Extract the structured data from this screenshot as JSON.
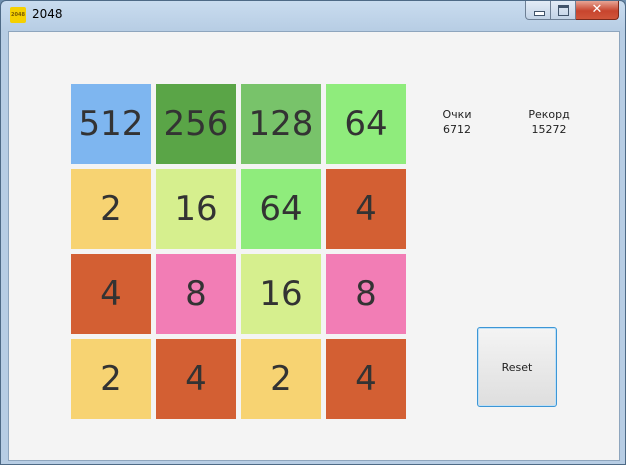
{
  "window": {
    "title": "2048",
    "icon_text": "2048",
    "close_glyph": "✕"
  },
  "board": {
    "tiles": [
      {
        "value": "512",
        "color": "#7eb6f0"
      },
      {
        "value": "256",
        "color": "#5aa547"
      },
      {
        "value": "128",
        "color": "#78c36a"
      },
      {
        "value": "64",
        "color": "#8fec7c"
      },
      {
        "value": "2",
        "color": "#f7d372"
      },
      {
        "value": "16",
        "color": "#d6ef8e"
      },
      {
        "value": "64",
        "color": "#8fec7c"
      },
      {
        "value": "4",
        "color": "#d35f33"
      },
      {
        "value": "4",
        "color": "#d35f33"
      },
      {
        "value": "8",
        "color": "#f27db5"
      },
      {
        "value": "16",
        "color": "#d6ef8e"
      },
      {
        "value": "8",
        "color": "#f27db5"
      },
      {
        "value": "2",
        "color": "#f7d372"
      },
      {
        "value": "4",
        "color": "#d35f33"
      },
      {
        "value": "2",
        "color": "#f7d372"
      },
      {
        "value": "4",
        "color": "#d35f33"
      }
    ]
  },
  "score": {
    "label": "Очки",
    "value": "6712"
  },
  "record": {
    "label": "Рекорд",
    "value": "15272"
  },
  "reset": {
    "label": "Reset"
  }
}
